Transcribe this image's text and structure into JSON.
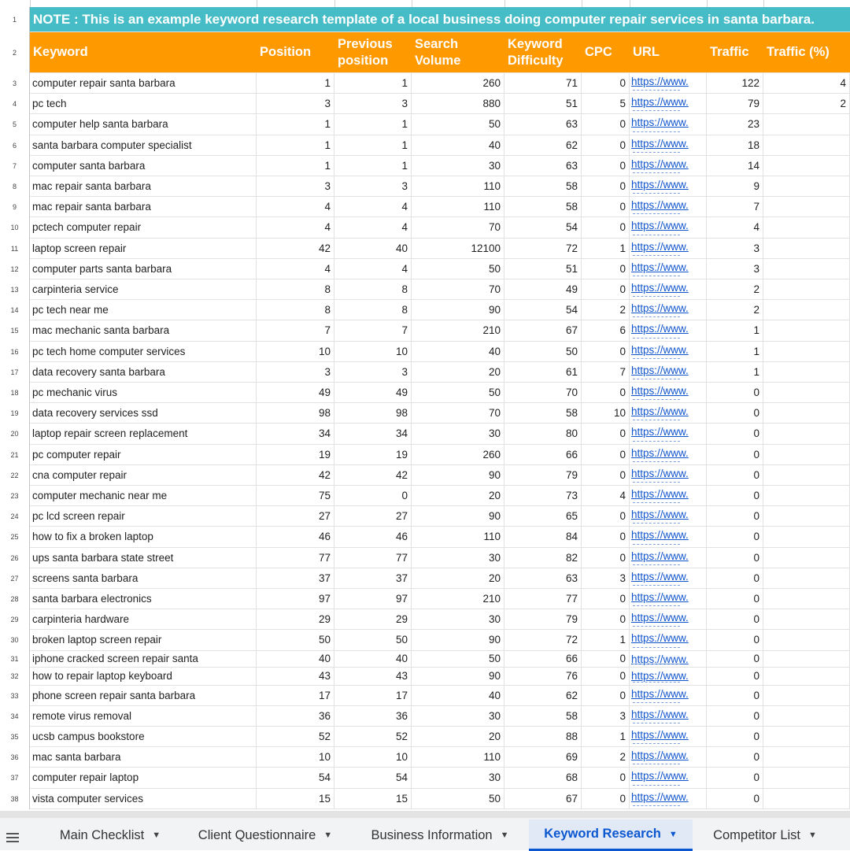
{
  "note": "NOTE : This is an example keyword research template of a local business doing computer repair services in santa barbara.",
  "headers": [
    "Keyword",
    "Position",
    "Previous position",
    "Search Volume",
    "Keyword Difficulty",
    "CPC",
    "URL",
    "Traffic",
    "Traffic (%)"
  ],
  "header_lines": {
    "keyword": "Keyword",
    "position": "Position",
    "prev1": "Previous",
    "prev2": "position",
    "vol1": "Search",
    "vol2": "Volume",
    "kd1": "Keyword",
    "kd2": "Difficulty",
    "cpc": "CPC",
    "url": "URL",
    "traffic": "Traffic",
    "traffic_pct": "Traffic (%)"
  },
  "row_numbers": [
    "1",
    "2",
    "3",
    "4",
    "5",
    "6",
    "7",
    "8",
    "9",
    "10",
    "11",
    "12",
    "13",
    "14",
    "15",
    "16",
    "17",
    "18",
    "19",
    "20",
    "21",
    "22",
    "23",
    "24",
    "25",
    "26",
    "27",
    "28",
    "29",
    "30",
    "31",
    "32",
    "33",
    "34",
    "35",
    "36",
    "37",
    "38"
  ],
  "url_text": "https://www.",
  "rows": [
    {
      "k": "computer repair santa barbara",
      "p": "1",
      "pp": "1",
      "v": "260",
      "d": "71",
      "c": "0",
      "t": "122",
      "tp": "4"
    },
    {
      "k": "pc tech",
      "p": "3",
      "pp": "3",
      "v": "880",
      "d": "51",
      "c": "5",
      "t": "79",
      "tp": "2"
    },
    {
      "k": "computer help santa barbara",
      "p": "1",
      "pp": "1",
      "v": "50",
      "d": "63",
      "c": "0",
      "t": "23",
      "tp": ""
    },
    {
      "k": "santa barbara computer specialist",
      "p": "1",
      "pp": "1",
      "v": "40",
      "d": "62",
      "c": "0",
      "t": "18",
      "tp": ""
    },
    {
      "k": "computer santa barbara",
      "p": "1",
      "pp": "1",
      "v": "30",
      "d": "63",
      "c": "0",
      "t": "14",
      "tp": ""
    },
    {
      "k": "mac repair santa barbara",
      "p": "3",
      "pp": "3",
      "v": "110",
      "d": "58",
      "c": "0",
      "t": "9",
      "tp": ""
    },
    {
      "k": "mac repair santa barbara",
      "p": "4",
      "pp": "4",
      "v": "110",
      "d": "58",
      "c": "0",
      "t": "7",
      "tp": ""
    },
    {
      "k": "pctech computer repair",
      "p": "4",
      "pp": "4",
      "v": "70",
      "d": "54",
      "c": "0",
      "t": "4",
      "tp": ""
    },
    {
      "k": "laptop screen repair",
      "p": "42",
      "pp": "40",
      "v": "12100",
      "d": "72",
      "c": "1",
      "t": "3",
      "tp": ""
    },
    {
      "k": "computer parts santa barbara",
      "p": "4",
      "pp": "4",
      "v": "50",
      "d": "51",
      "c": "0",
      "t": "3",
      "tp": ""
    },
    {
      "k": "carpinteria service",
      "p": "8",
      "pp": "8",
      "v": "70",
      "d": "49",
      "c": "0",
      "t": "2",
      "tp": ""
    },
    {
      "k": "pc tech near me",
      "p": "8",
      "pp": "8",
      "v": "90",
      "d": "54",
      "c": "2",
      "t": "2",
      "tp": ""
    },
    {
      "k": "mac mechanic santa barbara",
      "p": "7",
      "pp": "7",
      "v": "210",
      "d": "67",
      "c": "6",
      "t": "1",
      "tp": ""
    },
    {
      "k": "pc tech home computer services",
      "p": "10",
      "pp": "10",
      "v": "40",
      "d": "50",
      "c": "0",
      "t": "1",
      "tp": ""
    },
    {
      "k": "data recovery santa barbara",
      "p": "3",
      "pp": "3",
      "v": "20",
      "d": "61",
      "c": "7",
      "t": "1",
      "tp": ""
    },
    {
      "k": "pc mechanic virus",
      "p": "49",
      "pp": "49",
      "v": "50",
      "d": "70",
      "c": "0",
      "t": "0",
      "tp": ""
    },
    {
      "k": "data recovery services ssd",
      "p": "98",
      "pp": "98",
      "v": "70",
      "d": "58",
      "c": "10",
      "t": "0",
      "tp": ""
    },
    {
      "k": "laptop repair screen replacement",
      "p": "34",
      "pp": "34",
      "v": "30",
      "d": "80",
      "c": "0",
      "t": "0",
      "tp": ""
    },
    {
      "k": "pc computer repair",
      "p": "19",
      "pp": "19",
      "v": "260",
      "d": "66",
      "c": "0",
      "t": "0",
      "tp": ""
    },
    {
      "k": "cna computer repair",
      "p": "42",
      "pp": "42",
      "v": "90",
      "d": "79",
      "c": "0",
      "t": "0",
      "tp": ""
    },
    {
      "k": "computer mechanic near me",
      "p": "75",
      "pp": "0",
      "v": "20",
      "d": "73",
      "c": "4",
      "t": "0",
      "tp": ""
    },
    {
      "k": "pc lcd screen repair",
      "p": "27",
      "pp": "27",
      "v": "90",
      "d": "65",
      "c": "0",
      "t": "0",
      "tp": ""
    },
    {
      "k": "how to fix a broken laptop",
      "p": "46",
      "pp": "46",
      "v": "110",
      "d": "84",
      "c": "0",
      "t": "0",
      "tp": ""
    },
    {
      "k": "ups santa barbara state street",
      "p": "77",
      "pp": "77",
      "v": "30",
      "d": "82",
      "c": "0",
      "t": "0",
      "tp": ""
    },
    {
      "k": "screens santa barbara",
      "p": "37",
      "pp": "37",
      "v": "20",
      "d": "63",
      "c": "3",
      "t": "0",
      "tp": ""
    },
    {
      "k": "santa barbara electronics",
      "p": "97",
      "pp": "97",
      "v": "210",
      "d": "77",
      "c": "0",
      "t": "0",
      "tp": ""
    },
    {
      "k": "carpinteria hardware",
      "p": "29",
      "pp": "29",
      "v": "30",
      "d": "79",
      "c": "0",
      "t": "0",
      "tp": ""
    },
    {
      "k": "broken laptop screen repair",
      "p": "50",
      "pp": "50",
      "v": "90",
      "d": "72",
      "c": "1",
      "t": "0",
      "tp": ""
    },
    {
      "k": "iphone cracked screen repair santa",
      "p": "40",
      "pp": "40",
      "v": "50",
      "d": "66",
      "c": "0",
      "t": "0",
      "tp": ""
    },
    {
      "k": "how to repair laptop keyboard",
      "p": "43",
      "pp": "43",
      "v": "90",
      "d": "76",
      "c": "0",
      "t": "0",
      "tp": ""
    },
    {
      "k": "phone screen repair santa barbara",
      "p": "17",
      "pp": "17",
      "v": "40",
      "d": "62",
      "c": "0",
      "t": "0",
      "tp": ""
    },
    {
      "k": "remote virus removal",
      "p": "36",
      "pp": "36",
      "v": "30",
      "d": "58",
      "c": "3",
      "t": "0",
      "tp": ""
    },
    {
      "k": "ucsb campus bookstore",
      "p": "52",
      "pp": "52",
      "v": "20",
      "d": "88",
      "c": "1",
      "t": "0",
      "tp": ""
    },
    {
      "k": "mac santa barbara",
      "p": "10",
      "pp": "10",
      "v": "110",
      "d": "69",
      "c": "2",
      "t": "0",
      "tp": ""
    },
    {
      "k": "computer repair laptop",
      "p": "54",
      "pp": "54",
      "v": "30",
      "d": "68",
      "c": "0",
      "t": "0",
      "tp": ""
    },
    {
      "k": "vista computer services",
      "p": "15",
      "pp": "15",
      "v": "50",
      "d": "67",
      "c": "0",
      "t": "0",
      "tp": ""
    }
  ],
  "tabs": [
    {
      "label": "Main Checklist",
      "active": false
    },
    {
      "label": "Client Questionnaire",
      "active": false
    },
    {
      "label": "Business Information",
      "active": false
    },
    {
      "label": "Keyword Research",
      "active": true
    },
    {
      "label": "Competitor List",
      "active": false
    }
  ],
  "tab_caret": "▼",
  "colors": {
    "note_bg": "#46bdc6",
    "header_bg": "#ff9900",
    "link": "#1155cc",
    "active_tab": "#0b57d0"
  }
}
